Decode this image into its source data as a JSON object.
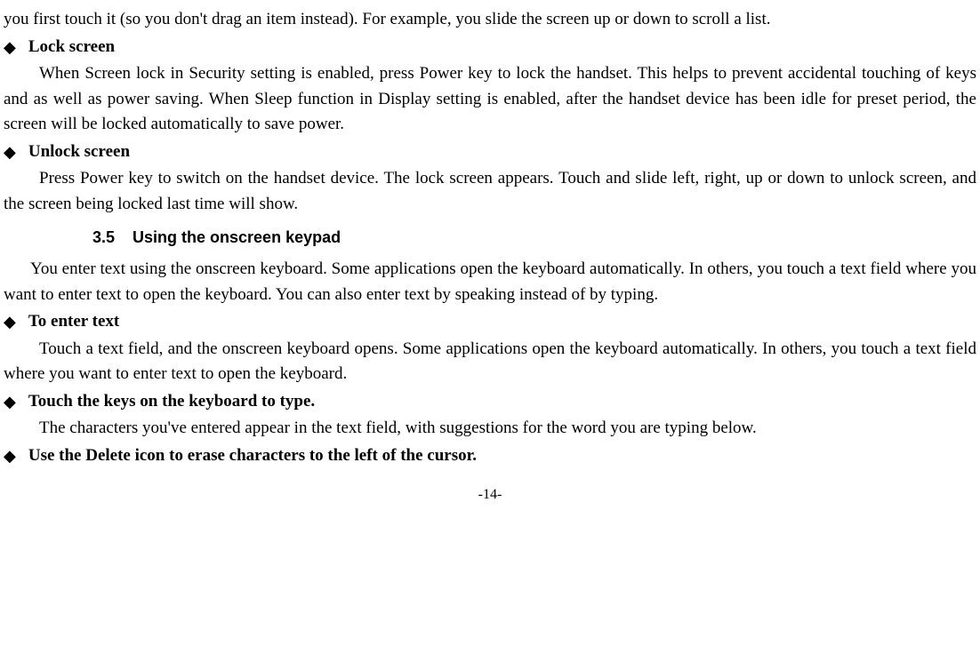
{
  "intro_fragment": "you first touch it (so you don't drag an item instead). For example, you slide the screen up or down to scroll a list.",
  "bullets": {
    "lock_screen": {
      "title": "Lock screen",
      "body": "When Screen lock in Security setting is enabled, press Power key to lock the handset. This helps to prevent accidental touching of keys and as well as power saving.   When Sleep function in Display setting is enabled, after the handset device has been idle for preset period, the screen will be locked automatically to save power."
    },
    "unlock_screen": {
      "title": "Unlock screen",
      "body": "Press Power key to switch on the handset device. The lock screen appears. Touch and slide left, right, up or down to unlock screen, and the screen being locked last time will show."
    },
    "to_enter_text": {
      "title": "To enter text",
      "body": "Touch a text field, and the onscreen keyboard opens. Some applications open the keyboard automatically. In others, you touch a text field where you want to enter text to open the keyboard."
    },
    "touch_keys": {
      "title": "Touch the keys on the keyboard to type.",
      "body": "The characters you've entered appear in the text field, with suggestions for the word you are typing below."
    },
    "use_delete": {
      "title": "Use the Delete icon to erase characters to the left of the cursor."
    }
  },
  "section": {
    "number": "3.5",
    "title": "Using the onscreen keypad",
    "intro": "You enter text using the onscreen keyboard. Some applications open the keyboard automatically. In others, you touch a text field where you want to enter text to open the keyboard. You can also enter text by speaking instead of by typing."
  },
  "page_number": "-14-"
}
